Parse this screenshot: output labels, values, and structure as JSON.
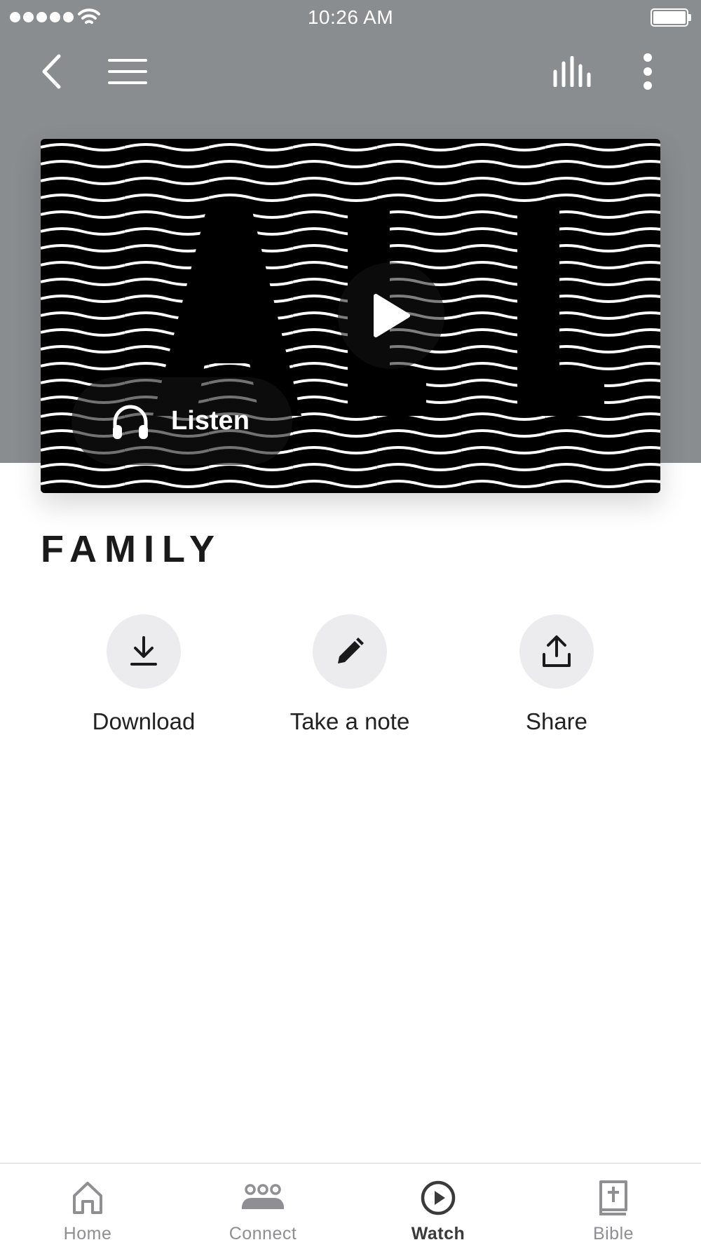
{
  "status_bar": {
    "time": "10:26 AM"
  },
  "nav": {
    "back_icon": "chevron-left-icon",
    "menu_icon": "hamburger-menu-icon",
    "audio_icon": "audio-bars-icon",
    "more_icon": "more-vertical-icon"
  },
  "media": {
    "artwork_text": "ALL",
    "play_icon": "play-icon",
    "listen_label": "Listen",
    "listen_icon": "headphones-icon"
  },
  "content": {
    "title": "FAMILY"
  },
  "actions": [
    {
      "label": "Download",
      "icon": "download-icon"
    },
    {
      "label": "Take a note",
      "icon": "pencil-icon"
    },
    {
      "label": "Share",
      "icon": "share-icon"
    }
  ],
  "tabs": [
    {
      "label": "Home",
      "icon": "home-icon",
      "active": false
    },
    {
      "label": "Connect",
      "icon": "group-icon",
      "active": false
    },
    {
      "label": "Watch",
      "icon": "play-circle-icon",
      "active": true
    },
    {
      "label": "Bible",
      "icon": "bible-icon",
      "active": false
    }
  ],
  "colors": {
    "header_background": "#8a8d8f",
    "action_circle": "#ececee",
    "tab_inactive": "#8e8e93",
    "tab_active": "#3a3a3a"
  }
}
